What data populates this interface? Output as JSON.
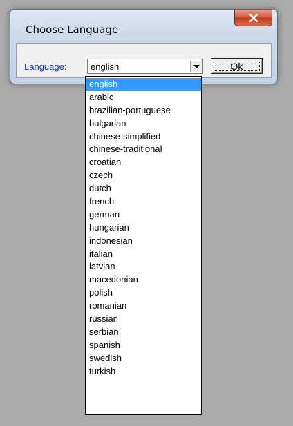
{
  "window": {
    "title": "Choose Language"
  },
  "form": {
    "language_label": "Language:",
    "selected_value": "english",
    "ok_label": "Ok"
  },
  "dropdown": {
    "selected_index": 0,
    "options": [
      "english",
      "arabic",
      "brazilian-portuguese",
      "bulgarian",
      "chinese-simplified",
      "chinese-traditional",
      "croatian",
      "czech",
      "dutch",
      "french",
      "german",
      "hungarian",
      "indonesian",
      "italian",
      "latvian",
      "macedonian",
      "polish",
      "romanian",
      "russian",
      "serbian",
      "spanish",
      "swedish",
      "turkish"
    ]
  },
  "icons": {
    "close": "close-icon",
    "dropdown_arrow": "chevron-down-icon"
  },
  "colors": {
    "selection": "#3399ff",
    "label_text": "#1a3cb8",
    "close_button": "#c23a1a"
  }
}
